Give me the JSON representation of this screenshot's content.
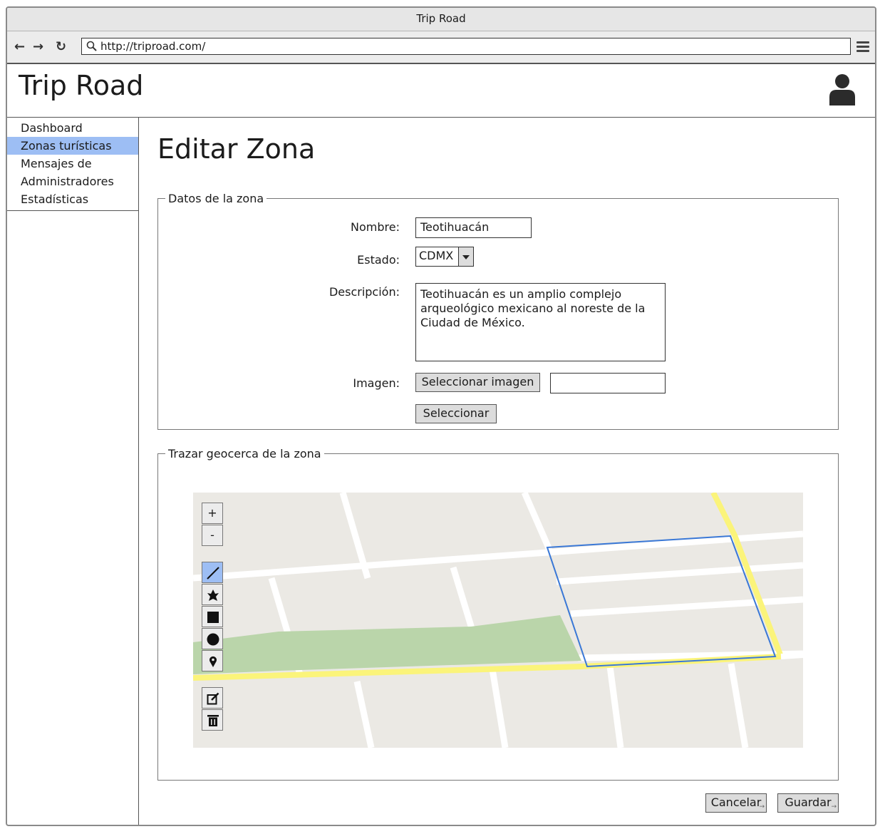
{
  "browser": {
    "window_title": "Trip Road",
    "url": "http://triproad.com/"
  },
  "header": {
    "app_title": "Trip Road"
  },
  "sidebar": {
    "items": [
      {
        "label": "Dashboard",
        "active": false
      },
      {
        "label": "Zonas turísticas",
        "active": true
      },
      {
        "label": "Mensajes de",
        "active": false
      },
      {
        "label": "Administradores",
        "active": false
      },
      {
        "label": "Estadísticas",
        "active": false
      }
    ]
  },
  "main": {
    "page_title": "Editar Zona",
    "zone_data": {
      "legend": "Datos de la zona",
      "name_label": "Nombre:",
      "name_value": "Teotihuacán",
      "state_label": "Estado:",
      "state_value": "CDMX",
      "description_label": "Descripción:",
      "description_value": "Teotihuacán es un amplio complejo arqueológico mexicano al noreste de la Ciudad de México.",
      "image_label": "Imagen:",
      "select_image_button": "Seleccionar imagen",
      "image_filename_value": "",
      "select_button": "Seleccionar"
    },
    "geofence": {
      "legend": "Trazar geocerca de la zona",
      "zoom_in": "+",
      "zoom_out": "-"
    },
    "actions": {
      "cancel": "Cancelar",
      "save": "Guardar"
    }
  },
  "colors": {
    "active_nav": "#9dbef4",
    "geofence_line": "#3a78d6",
    "main_road": "#fbf47a",
    "park": "#bad5aa",
    "map_background": "#ebe9e4"
  }
}
